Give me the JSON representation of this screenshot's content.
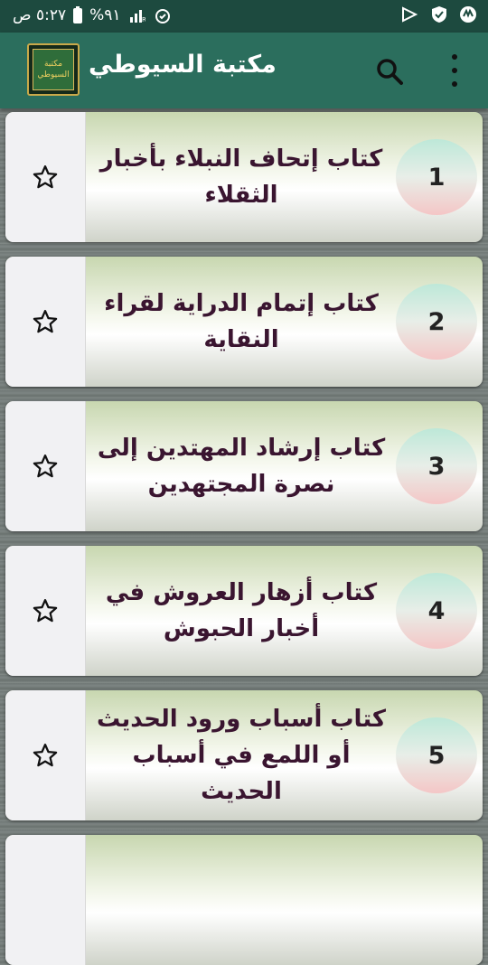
{
  "status_bar": {
    "time": "٥:٢٧ ص",
    "battery": "%٩١",
    "icons": [
      "alarm-icon",
      "signal-icon",
      "battery-icon",
      "app-icon-1",
      "vpn-icon",
      "play-icon"
    ]
  },
  "app_bar": {
    "title": "مكتبة السيوطي",
    "logo_line1": "مكتبة",
    "logo_line2": "السيوطي",
    "search_icon": "search-icon",
    "menu_icon": "more-vert-icon"
  },
  "books": [
    {
      "number": "1",
      "title": "كتاب إتحاف النبلاء بأخبار الثقلاء"
    },
    {
      "number": "2",
      "title": "كتاب إتمام الدراية لقراء النقاية"
    },
    {
      "number": "3",
      "title": "كتاب إرشاد المهتدين إلى نصرة المجتهدين"
    },
    {
      "number": "4",
      "title": "كتاب أزهار العروش في أخبار الحبوش"
    },
    {
      "number": "5",
      "title": "كتاب أسباب ورود الحديث أو اللمع في أسباب الحديث"
    }
  ],
  "colors": {
    "status_bar": "#1d4a3f",
    "app_bar": "#2b6e5d",
    "title_text": "#3a1530"
  }
}
